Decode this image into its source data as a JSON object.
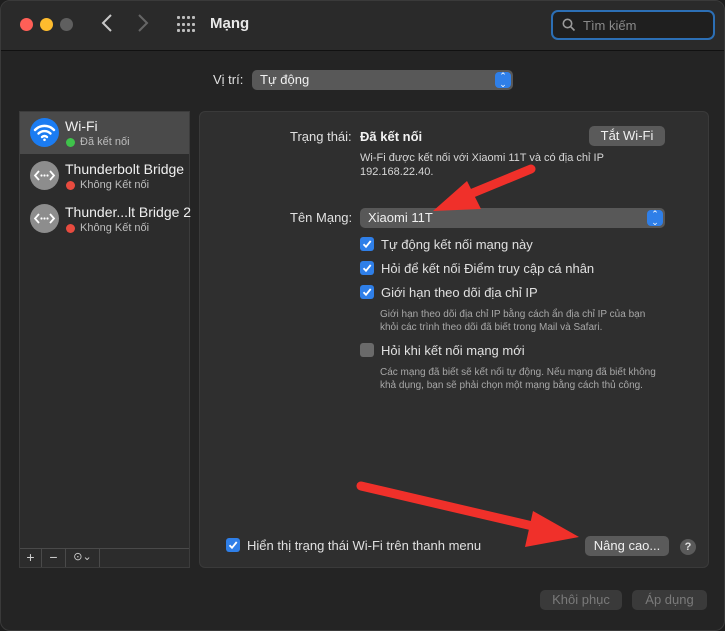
{
  "window": {
    "title": "Mạng",
    "search_placeholder": "Tìm kiếm"
  },
  "location": {
    "label": "Vị trí:",
    "value": "Tự động"
  },
  "services": [
    {
      "name": "Wi-Fi",
      "status": "Đã kết nối",
      "status_color": "#3fc24b",
      "icon": "wifi-icon",
      "selected": true
    },
    {
      "name": "Thunderbolt Bridge",
      "status": "Không Kết nối",
      "status_color": "#e84b3f",
      "icon": "thunderbolt-bridge-icon",
      "selected": false
    },
    {
      "name": "Thunder...lt Bridge 2",
      "status": "Không Kết nối",
      "status_color": "#e84b3f",
      "icon": "thunderbolt-bridge-icon",
      "selected": false
    }
  ],
  "sidebar_toolbar": {
    "add": "+",
    "remove": "−",
    "action": "⊙⌄"
  },
  "detail": {
    "status_label": "Trạng thái:",
    "status_value": "Đã kết nối",
    "turn_off_button": "Tắt Wi-Fi",
    "status_desc_line1": "Wi-Fi được kết nối với Xiaomi 11T và có địa chỉ IP",
    "status_desc_line2": "192.168.22.40.",
    "network_label": "Tên Mạng:",
    "network_value": "Xiaomi 11T",
    "options": [
      {
        "label": "Tự động kết nối mạng này",
        "checked": true
      },
      {
        "label": "Hỏi để kết nối Điểm truy cập cá nhân",
        "checked": true
      },
      {
        "label": "Giới hạn theo dõi địa chỉ IP",
        "checked": true
      },
      {
        "label": "Hỏi khi kết nối mạng mới",
        "checked": false
      }
    ],
    "limit_ip_desc_line1": "Giới hạn theo dõi địa chỉ IP bằng cách ẩn địa chỉ IP của bạn",
    "limit_ip_desc_line2": "khỏi các trình theo dõi đã biết trong Mail và Safari.",
    "ask_join_desc_line1": "Các mạng đã biết sẽ kết nối tự động. Nếu mạng đã biết không",
    "ask_join_desc_line2": "khả dụng, bạn sẽ phải chọn một mạng bằng cách thủ công.",
    "show_status_label": "Hiển thị trạng thái Wi-Fi trên thanh menu",
    "show_status_checked": true,
    "advanced_button": "Nâng cao...",
    "help_button": "?"
  },
  "footer": {
    "revert_button": "Khôi phục",
    "apply_button": "Áp dụng"
  },
  "colors": {
    "accent": "#2f7fe8",
    "annotation_arrow": "#f0302a"
  }
}
